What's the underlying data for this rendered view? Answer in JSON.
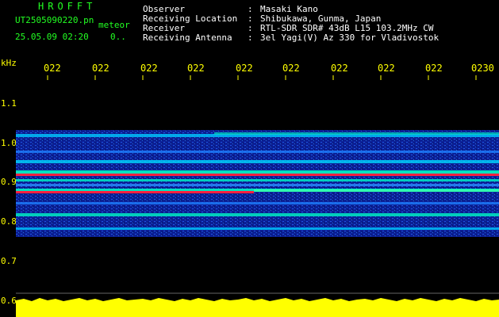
{
  "header": {
    "brand": "HROFFT",
    "filename": "UT2505090220.pn",
    "mode": "meteor",
    "datetime": "25.05.09 02:20",
    "count": "0..",
    "observer_label": "Observer",
    "observer_sep": ":",
    "observer_value": "Masaki Kano",
    "location_label": "Receiving Location",
    "location_sep": ":",
    "location_value": "Shibukawa, Gunma, Japan",
    "receiver_label": "Receiver",
    "receiver_sep": ":",
    "receiver_value": "RTL-SDR SDR# 43dB L15 103.2MHz CW",
    "antenna_label": "Receiving Antenna",
    "antenna_sep": ":",
    "antenna_value": "3el Yagi(V) Az 330 for Vladivostok"
  },
  "axes": {
    "y_unit": "kHz",
    "y_ticks": [
      "1.1",
      "1.0",
      "0.9",
      "0.8",
      "0.7",
      "0.6"
    ],
    "x_ticks": [
      "022",
      "022",
      "022",
      "022",
      "022",
      "022",
      "022",
      "022",
      "022",
      "0230"
    ]
  },
  "colors": {
    "background": "#000000",
    "band_base": "#0a1a8a",
    "band_bright": "#2a6cff",
    "line_cyan": "#00e0c0",
    "line_red": "#ff2040",
    "noise": "#ffff00",
    "text_green": "#22ff22",
    "text_yellow": "#ffff00"
  }
}
